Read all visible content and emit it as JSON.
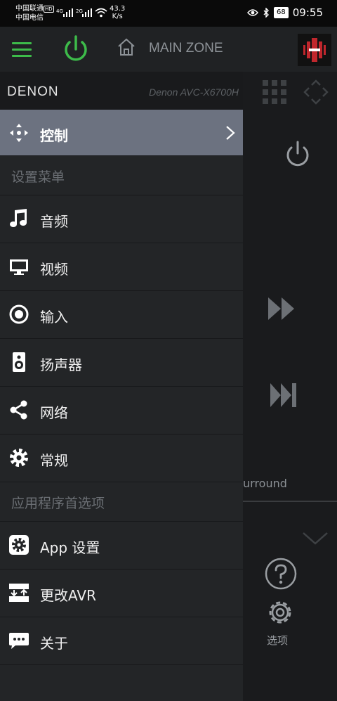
{
  "status_bar": {
    "carrier1": "中国联通",
    "carrier2": "中国电信",
    "hd_badge": "HD",
    "net1": "4G",
    "net2": "2G",
    "speed_value": "43.3",
    "speed_unit": "K/s",
    "battery": "68",
    "time": "09:55"
  },
  "app_bar": {
    "zone_title": "MAIN ZONE"
  },
  "drawer": {
    "brand": "DENON",
    "model": "Denon AVC-X6700H",
    "active_item": "控制",
    "section_settings": "设置菜单",
    "items_settings": [
      "音频",
      "视频",
      "输入",
      "扬声器",
      "网络",
      "常规"
    ],
    "section_app": "应用程序首选项",
    "items_app": [
      "App 设置",
      "更改AVR",
      "关于"
    ]
  },
  "background": {
    "surround_text": "urround",
    "options_label": "选项"
  },
  "colors": {
    "accent_green": "#3dbb4a",
    "active_row": "#6c7280",
    "drawer_bg": "#232527"
  }
}
